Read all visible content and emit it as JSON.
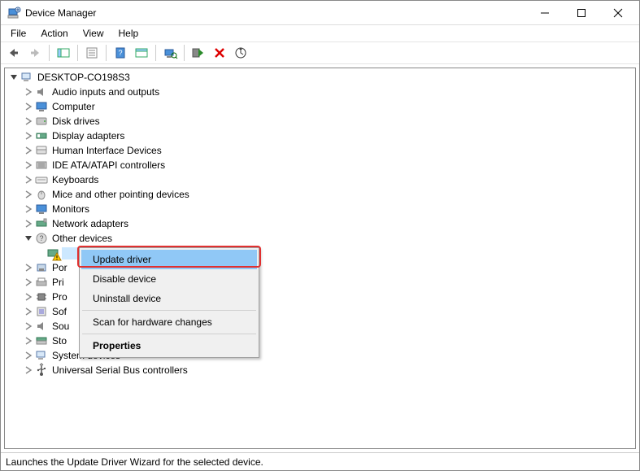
{
  "window": {
    "title": "Device Manager"
  },
  "menu": {
    "file": "File",
    "action": "Action",
    "view": "View",
    "help": "Help"
  },
  "tree": {
    "root": "DESKTOP-CO198S3",
    "items": [
      "Audio inputs and outputs",
      "Computer",
      "Disk drives",
      "Display adapters",
      "Human Interface Devices",
      "IDE ATA/ATAPI controllers",
      "Keyboards",
      "Mice and other pointing devices",
      "Monitors",
      "Network adapters",
      "Other devices"
    ],
    "other_expanded": true,
    "other_child_label_visible": "",
    "remaining_partial": [
      "Por",
      "Pri",
      "Pro",
      "Sof",
      "Sou",
      "Sto"
    ],
    "remaining_full": [
      "System devices",
      "Universal Serial Bus controllers"
    ]
  },
  "context_menu": {
    "update": "Update driver",
    "disable": "Disable device",
    "uninstall": "Uninstall device",
    "scan": "Scan for hardware changes",
    "properties": "Properties"
  },
  "status": "Launches the Update Driver Wizard for the selected device."
}
